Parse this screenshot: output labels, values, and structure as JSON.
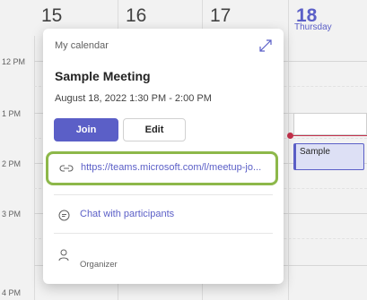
{
  "calendar": {
    "days": [
      {
        "num": "15",
        "name": ""
      },
      {
        "num": "16",
        "name": ""
      },
      {
        "num": "17",
        "name": ""
      },
      {
        "num": "18",
        "name": "Thursday",
        "today": true
      }
    ],
    "times": [
      "12 PM",
      "1 PM",
      "2 PM",
      "3 PM",
      "4 PM"
    ],
    "event_title": "Sample"
  },
  "popup": {
    "calendar_name": "My calendar",
    "title": "Sample Meeting",
    "datetime": "August 18, 2022 1:30 PM - 2:00 PM",
    "join_label": "Join",
    "edit_label": "Edit",
    "link": "https://teams.microsoft.com/l/meetup-jo...",
    "chat_label": "Chat with participants",
    "organizer_label": "Organizer",
    "icons": [
      "expand-icon",
      "link-icon",
      "chat-icon",
      "person-icon"
    ],
    "colors": {
      "accent": "#5b5fc7",
      "highlight": "#8db84a",
      "now": "#c4314b"
    }
  }
}
